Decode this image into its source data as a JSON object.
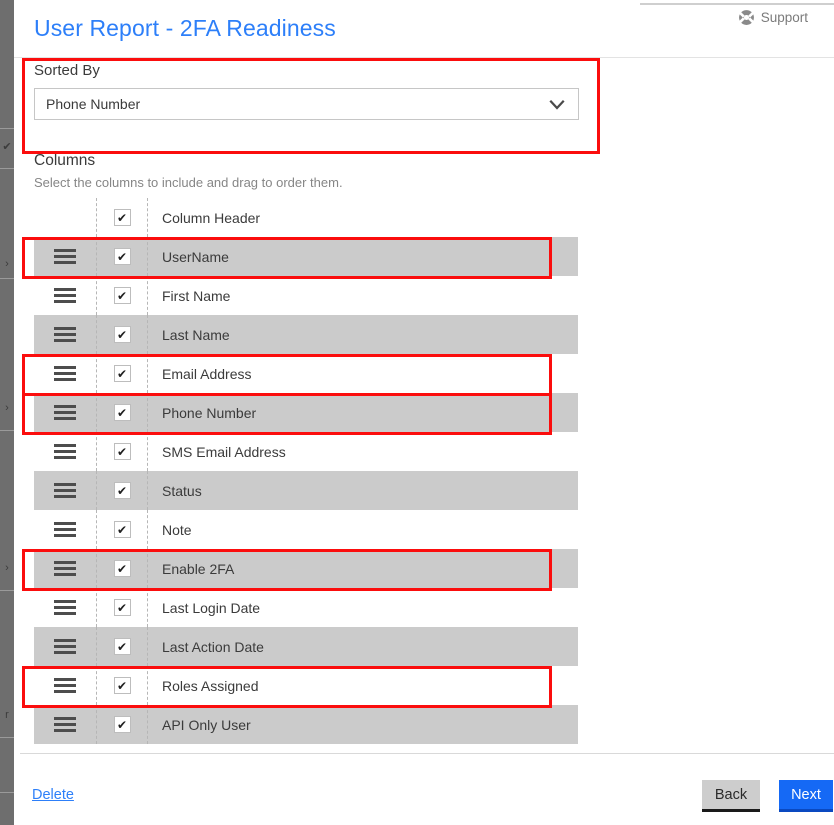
{
  "header": {
    "title": "User Report - 2FA Readiness",
    "support_label": "Support",
    "support_icon": "lifebuoy-icon",
    "title_color": "#2d7ff9"
  },
  "sorted_by": {
    "label": "Sorted By",
    "selected_value": "Phone Number",
    "chevron_icon": "chevron-down-icon"
  },
  "columns": {
    "title": "Columns",
    "help_text": "Select the columns to include and drag to order them.",
    "drag_icon": "drag-handle-icon",
    "check_glyph": "✔",
    "items": [
      {
        "label": "Column Header",
        "checked": true,
        "draggable": false,
        "shaded": false,
        "highlighted": false
      },
      {
        "label": "UserName",
        "checked": true,
        "draggable": true,
        "shaded": true,
        "highlighted": true
      },
      {
        "label": "First Name",
        "checked": true,
        "draggable": true,
        "shaded": false,
        "highlighted": false
      },
      {
        "label": "Last Name",
        "checked": true,
        "draggable": true,
        "shaded": true,
        "highlighted": false
      },
      {
        "label": "Email Address",
        "checked": true,
        "draggable": true,
        "shaded": false,
        "highlighted": true
      },
      {
        "label": "Phone Number",
        "checked": true,
        "draggable": true,
        "shaded": true,
        "highlighted": true
      },
      {
        "label": "SMS Email Address",
        "checked": true,
        "draggable": true,
        "shaded": false,
        "highlighted": false
      },
      {
        "label": "Status",
        "checked": true,
        "draggable": true,
        "shaded": true,
        "highlighted": false
      },
      {
        "label": "Note",
        "checked": true,
        "draggable": true,
        "shaded": false,
        "highlighted": false
      },
      {
        "label": "Enable 2FA",
        "checked": true,
        "draggable": true,
        "shaded": true,
        "highlighted": true
      },
      {
        "label": "Last Login Date",
        "checked": true,
        "draggable": true,
        "shaded": false,
        "highlighted": false
      },
      {
        "label": "Last Action Date",
        "checked": true,
        "draggable": true,
        "shaded": true,
        "highlighted": false
      },
      {
        "label": "Roles Assigned",
        "checked": true,
        "draggable": true,
        "shaded": false,
        "highlighted": true
      },
      {
        "label": "API Only User",
        "checked": true,
        "draggable": true,
        "shaded": true,
        "highlighted": false
      }
    ]
  },
  "footer": {
    "delete_label": "Delete",
    "back_label": "Back",
    "next_label": "Next",
    "next_color": "#1569f5",
    "delete_color": "#2d7ff9"
  },
  "annotations": {
    "color": "#fb0d0d",
    "sorted_by_box": true
  },
  "background_ghost": {
    "marks": [
      "✔",
      "›",
      "›",
      "›",
      "r"
    ]
  }
}
